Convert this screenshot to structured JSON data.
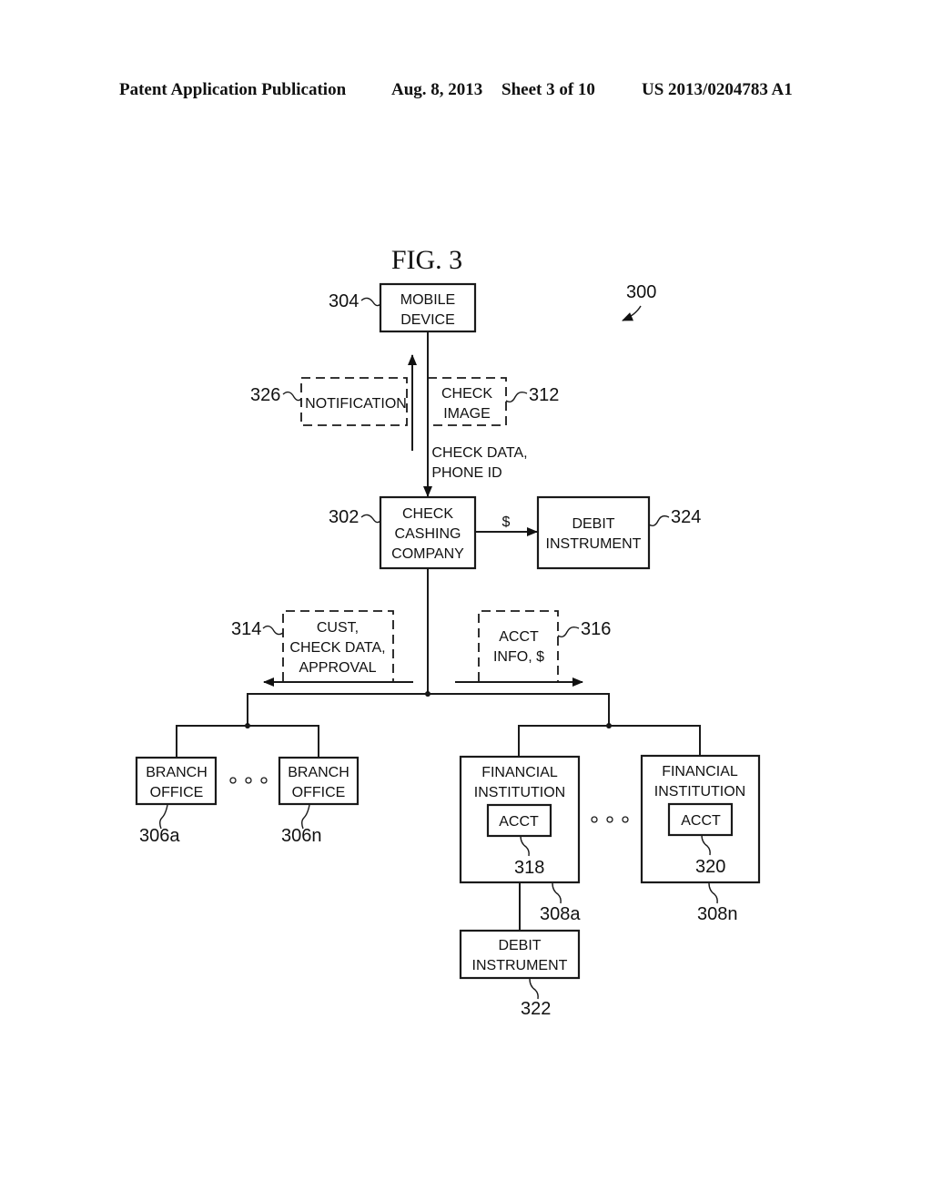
{
  "header": {
    "publication": "Patent Application Publication",
    "date": "Aug. 8, 2013",
    "sheet": "Sheet 3 of 10",
    "number": "US 2013/0204783 A1"
  },
  "figure": {
    "title": "FIG. 3",
    "ref": "300"
  },
  "nodes": {
    "mobile_device": {
      "lines": [
        "MOBILE",
        "DEVICE"
      ],
      "ref": "304"
    },
    "notification": {
      "lines": [
        "NOTIFICATION"
      ],
      "ref": "326"
    },
    "check_image": {
      "lines": [
        "CHECK",
        "IMAGE"
      ],
      "ref": "312"
    },
    "check_data_label": {
      "lines": [
        "CHECK DATA,",
        "PHONE ID"
      ]
    },
    "check_cashing": {
      "lines": [
        "CHECK",
        "CASHING",
        "COMPANY"
      ],
      "ref": "302"
    },
    "dollar_label": "$",
    "debit_instrument_top": {
      "lines": [
        "DEBIT",
        "INSTRUMENT"
      ],
      "ref": "324"
    },
    "cust_data": {
      "lines": [
        "CUST,",
        "CHECK DATA,",
        "APPROVAL"
      ],
      "ref": "314"
    },
    "acct_info": {
      "lines": [
        "ACCT",
        "INFO, $"
      ],
      "ref": "316"
    },
    "branch_a": {
      "lines": [
        "BRANCH",
        "OFFICE"
      ],
      "ref": "306a"
    },
    "branch_n": {
      "lines": [
        "BRANCH",
        "OFFICE"
      ],
      "ref": "306n"
    },
    "fin_a": {
      "lines": [
        "FINANCIAL",
        "INSTITUTION"
      ],
      "ref": "308a",
      "acct": "ACCT",
      "acct_ref": "318"
    },
    "fin_n": {
      "lines": [
        "FINANCIAL",
        "INSTITUTION"
      ],
      "ref": "308n",
      "acct": "ACCT",
      "acct_ref": "320"
    },
    "debit_instrument_bottom": {
      "lines": [
        "DEBIT",
        "INSTRUMENT"
      ],
      "ref": "322"
    }
  }
}
